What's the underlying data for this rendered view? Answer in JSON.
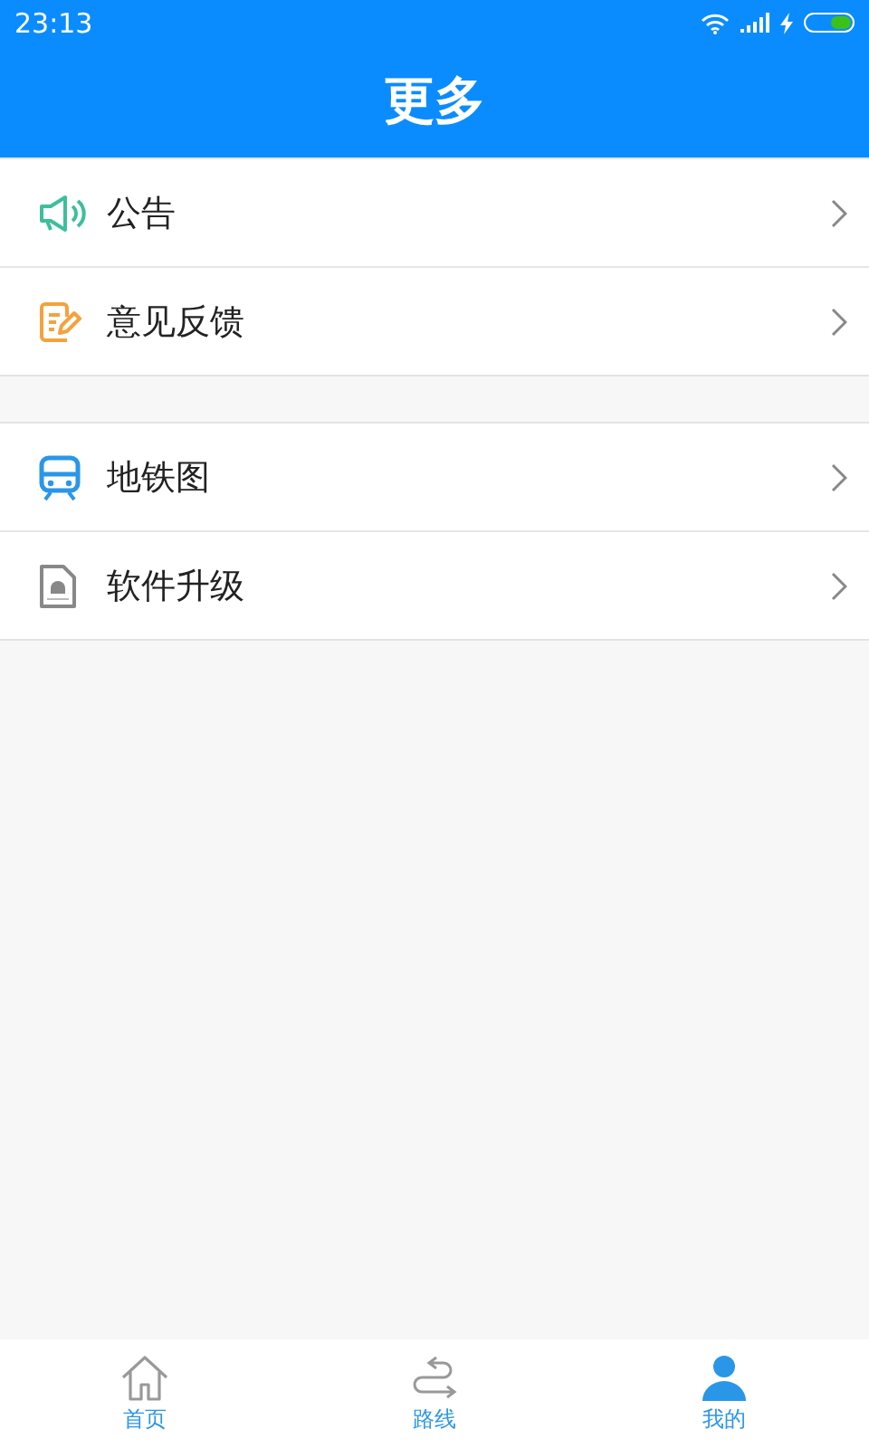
{
  "status_bar": {
    "time": "23:13"
  },
  "header": {
    "title": "更多"
  },
  "sections": [
    {
      "items": [
        {
          "kind": "announce",
          "label": "公告"
        },
        {
          "kind": "feedback",
          "label": "意见反馈"
        }
      ]
    },
    {
      "items": [
        {
          "kind": "subway",
          "label": "地铁图"
        },
        {
          "kind": "apk",
          "label": "软件升级"
        }
      ]
    }
  ],
  "tabs": [
    {
      "kind": "home",
      "label": "首页",
      "selected": false
    },
    {
      "kind": "route",
      "label": "路线",
      "selected": false
    },
    {
      "kind": "me",
      "label": "我的",
      "selected": true
    }
  ]
}
